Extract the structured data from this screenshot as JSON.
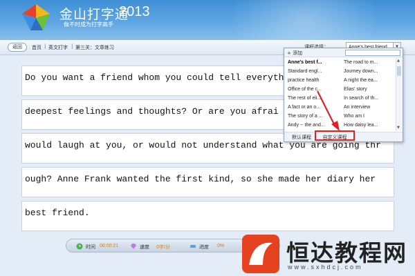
{
  "app": {
    "title": "金山打字通",
    "year": "2013",
    "slogan": "做不时成为打字高手"
  },
  "toolbar": {
    "back_label": "返回",
    "breadcrumbs": [
      "首页",
      "英文打字",
      "第三关：文章练习"
    ],
    "course_label": "课程选择：",
    "course_value": "Anne's best friend"
  },
  "practice_lines": [
    "Do you want a friend whom you could tell everyth",
    "deepest feelings and thoughts? Or are you afrai",
    "would laugh at you, or would not understand what you are going thr",
    "ough? Anne Frank wanted the first kind, so she made her diary her",
    "best friend."
  ],
  "status": {
    "time_label": "时间",
    "time_value": "00:00:21",
    "speed_label": "速度",
    "speed_value": "0字/分",
    "progress_label": "进度",
    "progress_value": "0%"
  },
  "dropdown": {
    "add_label": "添加",
    "search_placeholder": "",
    "left_items": [
      "Anne's best f...",
      "Standard engl...",
      "practice health",
      "Office of the c...",
      "The rest of eli...",
      "A fact or an o...",
      "The story of a ...",
      "Andy -- the and..."
    ],
    "right_items": [
      "The road to m...",
      "Journey down...",
      "A night the ea...",
      "Elias' story",
      "In search of th...",
      "An interview",
      "Who am I",
      "How daisy lea..."
    ],
    "selected_index": 0,
    "tab_default": "默认课程",
    "tab_custom": "自定义课程"
  },
  "watermark": {
    "text": "恒达教程网",
    "url": "www.sxhdcj.com"
  },
  "colors": {
    "header": "#4f9cdd",
    "highlight": "#e02020",
    "status_value": "#e07b00",
    "watermark_logo": "#e5431f"
  }
}
